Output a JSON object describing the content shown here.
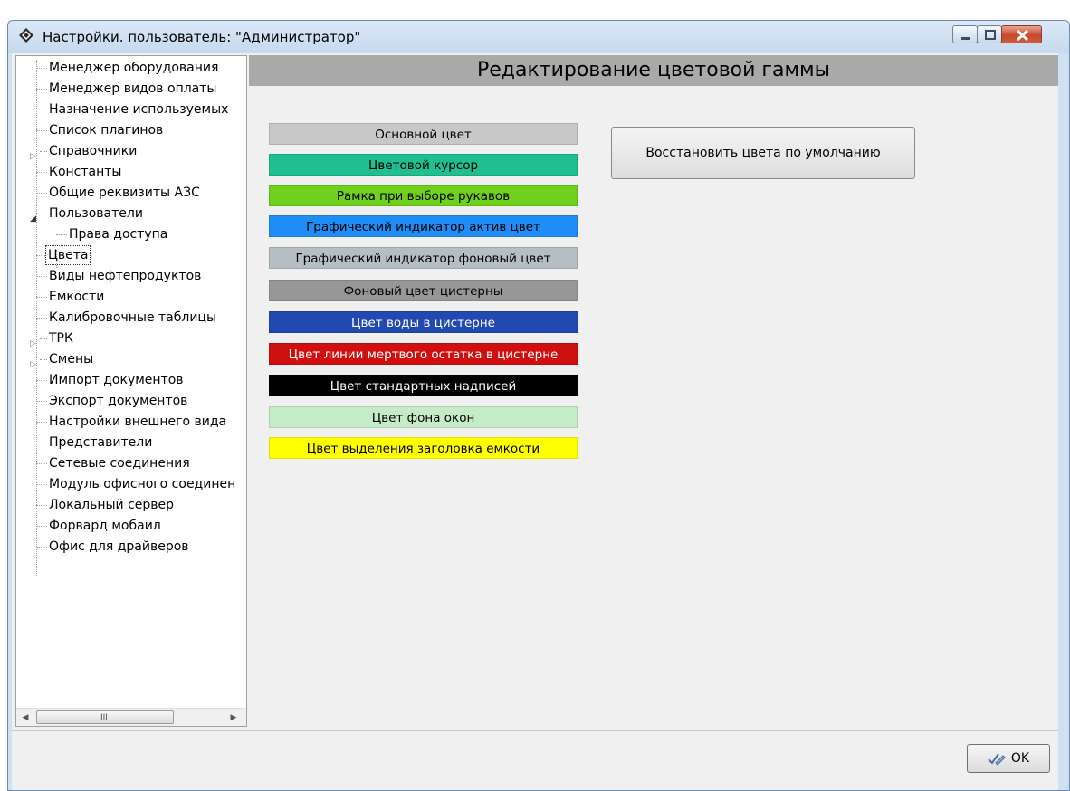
{
  "window": {
    "title": "Настройки. пользователь: \"Администратор\"",
    "icon": "diamond-app-icon",
    "controls": [
      "minimize-icon",
      "maximize-icon",
      "close-icon"
    ]
  },
  "tree": {
    "items": [
      {
        "label": "Менеджер оборудования"
      },
      {
        "label": "Менеджер видов оплаты"
      },
      {
        "label": "Назначение используемых"
      },
      {
        "label": "Список плагинов"
      },
      {
        "label": "Справочники",
        "expander": "collapsed"
      },
      {
        "label": "Константы"
      },
      {
        "label": "Общие реквизиты АЗС"
      },
      {
        "label": "Пользователи",
        "expander": "expanded"
      },
      {
        "label": "Права доступа",
        "child": true
      },
      {
        "label": "Цвета",
        "selected": true
      },
      {
        "label": "Виды нефтепродуктов"
      },
      {
        "label": "Емкости"
      },
      {
        "label": "Калибровочные таблицы"
      },
      {
        "label": "ТРК",
        "expander": "collapsed"
      },
      {
        "label": "Смены",
        "expander": "collapsed"
      },
      {
        "label": "Импорт документов"
      },
      {
        "label": "Экспорт документов"
      },
      {
        "label": "Настройки внешнего вида"
      },
      {
        "label": "Представители"
      },
      {
        "label": "Сетевые соединения"
      },
      {
        "label": "Модуль офисного соединен"
      },
      {
        "label": "Локальный сервер"
      },
      {
        "label": "Форвард мобаил"
      },
      {
        "label": "Офис для драйверов"
      }
    ],
    "scroll_grip": "III"
  },
  "main": {
    "heading": "Редактирование цветовой гаммы",
    "restore_button": "Восстановить цвета по умолчанию",
    "swatches": [
      {
        "label": "Основной цвет",
        "bg": "#c8c8c8",
        "fg": "#000000"
      },
      {
        "label": "Цветовой курсор",
        "bg": "#1fbf8f",
        "fg": "#000000"
      },
      {
        "label": "Рамка при выборе рукавов",
        "bg": "#6fd11d",
        "fg": "#000000"
      },
      {
        "label": "Графический индикатор актив цвет",
        "bg": "#1e8df5",
        "fg": "#000000"
      },
      {
        "label": "Графический индикатор фоновый цвет",
        "bg": "#b4bec3",
        "fg": "#000000"
      },
      {
        "label": "Фоновый цвет цистерны",
        "bg": "#979797",
        "fg": "#000000"
      },
      {
        "label": "Цвет воды в цистерне",
        "bg": "#2249b0",
        "fg": "#ffffff"
      },
      {
        "label": "Цвет линии мертвого остатка в цистерне",
        "bg": "#d00f0f",
        "fg": "#ffffff"
      },
      {
        "label": "Цвет стандартных надписей",
        "bg": "#000000",
        "fg": "#ffffff"
      },
      {
        "label": "Цвет фона окон",
        "bg": "#c5ecc6",
        "fg": "#000000"
      },
      {
        "label": "Цвет выделения заголовка емкости",
        "bg": "#ffff00",
        "fg": "#000000"
      }
    ]
  },
  "footer": {
    "ok_label": "OK",
    "ok_icon": "checkmark-pencil-icon"
  }
}
